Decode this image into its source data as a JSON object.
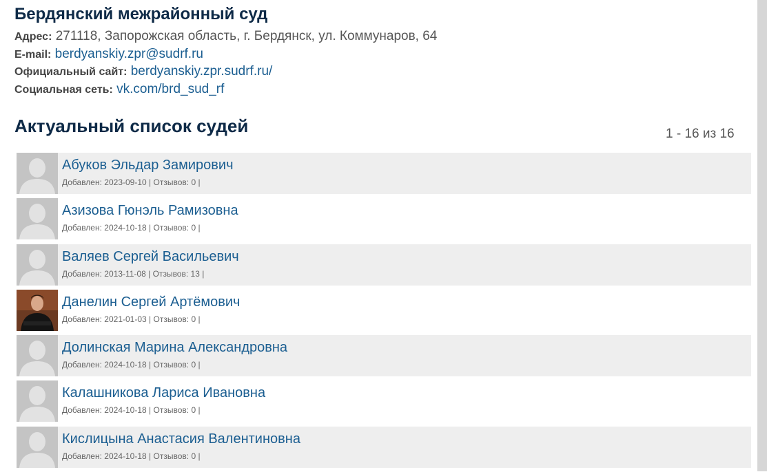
{
  "court": {
    "title": "Бердянский межрайонный суд",
    "address_label": "Адрес:",
    "address": "271118, Запорожская область, г. Бердянск, ул. Коммунаров, 64",
    "email_label": "E-mail:",
    "email": "berdyanskiy.zpr@sudrf.ru",
    "site_label": "Официальный сайт:",
    "site": "berdyanskiy.zpr.sudrf.ru/",
    "social_label": "Социальная сеть:",
    "social": "vk.com/brd_sud_rf"
  },
  "judges_section": {
    "title": "Актуальный список судей",
    "pager": "1 - 16 из 16"
  },
  "meta_labels": {
    "added": "Добавлен:",
    "reviews": "Отзывов:",
    "sep": "|"
  },
  "judges": [
    {
      "name": "Абуков Эльдар Замирович",
      "added": "2023-09-10",
      "reviews": "0",
      "photo": "placeholder-avatar-icon"
    },
    {
      "name": "Азизова Гюнэль Рамизовна",
      "added": "2024-10-18",
      "reviews": "0",
      "photo": "placeholder-avatar-icon"
    },
    {
      "name": "Валяев Сергей Васильевич",
      "added": "2013-11-08",
      "reviews": "13",
      "photo": "placeholder-avatar-icon"
    },
    {
      "name": "Данелин Сергей Артёмович",
      "added": "2021-01-03",
      "reviews": "0",
      "photo": "judge-photo"
    },
    {
      "name": "Долинская Марина Александровна",
      "added": "2024-10-18",
      "reviews": "0",
      "photo": "placeholder-avatar-icon"
    },
    {
      "name": "Калашникова Лариса Ивановна",
      "added": "2024-10-18",
      "reviews": "0",
      "photo": "placeholder-avatar-icon"
    },
    {
      "name": "Кислицына Анастасия Валентиновна",
      "added": "2024-10-18",
      "reviews": "0",
      "photo": "placeholder-avatar-icon"
    }
  ],
  "colors": {
    "link": "#1b5e91",
    "heading": "#0e2a47",
    "row_bg": "#eeeeee"
  }
}
